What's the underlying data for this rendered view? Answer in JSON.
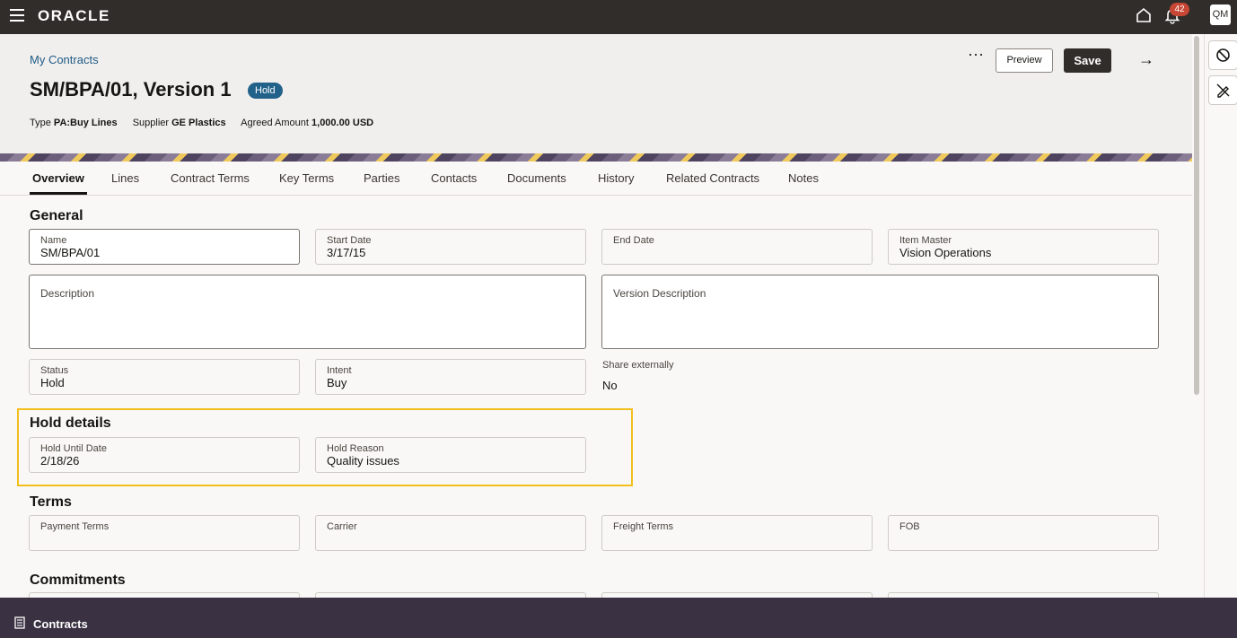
{
  "topbar": {
    "brand": "ORACLE",
    "notification_count": "42",
    "user_initials": "QM"
  },
  "header": {
    "breadcrumb": "My Contracts",
    "title": "SM/BPA/01, Version 1",
    "status": "Hold",
    "type_label": "Type",
    "type_value": "PA:Buy Lines",
    "supplier_label": "Supplier",
    "supplier_value": "GE Plastics",
    "amount_label": "Agreed Amount",
    "amount_value": "1,000.00 USD",
    "more_label": "···",
    "preview_label": "Preview",
    "save_label": "Save",
    "arrow_label": "→"
  },
  "tabs": [
    "Overview",
    "Lines",
    "Contract Terms",
    "Key Terms",
    "Parties",
    "Contacts",
    "Documents",
    "History",
    "Related Contracts",
    "Notes"
  ],
  "general": {
    "title": "General",
    "name_label": "Name",
    "name_value": "SM/BPA/01",
    "start_label": "Start Date",
    "start_value": "3/17/15",
    "end_label": "End Date",
    "end_value": "",
    "item_master_label": "Item Master",
    "item_master_value": "Vision Operations",
    "description_label": "Description",
    "version_description_label": "Version Description",
    "status_label": "Status",
    "status_value": "Hold",
    "intent_label": "Intent",
    "intent_value": "Buy",
    "share_label": "Share externally",
    "share_value": "No"
  },
  "hold": {
    "title": "Hold details",
    "until_label": "Hold Until Date",
    "until_value": "2/18/26",
    "reason_label": "Hold Reason",
    "reason_value": "Quality issues"
  },
  "terms": {
    "title": "Terms",
    "payment_label": "Payment Terms",
    "carrier_label": "Carrier",
    "freight_label": "Freight Terms",
    "fob_label": "FOB"
  },
  "commitments": {
    "title": "Commitments"
  },
  "footer": {
    "label": "Contracts"
  }
}
